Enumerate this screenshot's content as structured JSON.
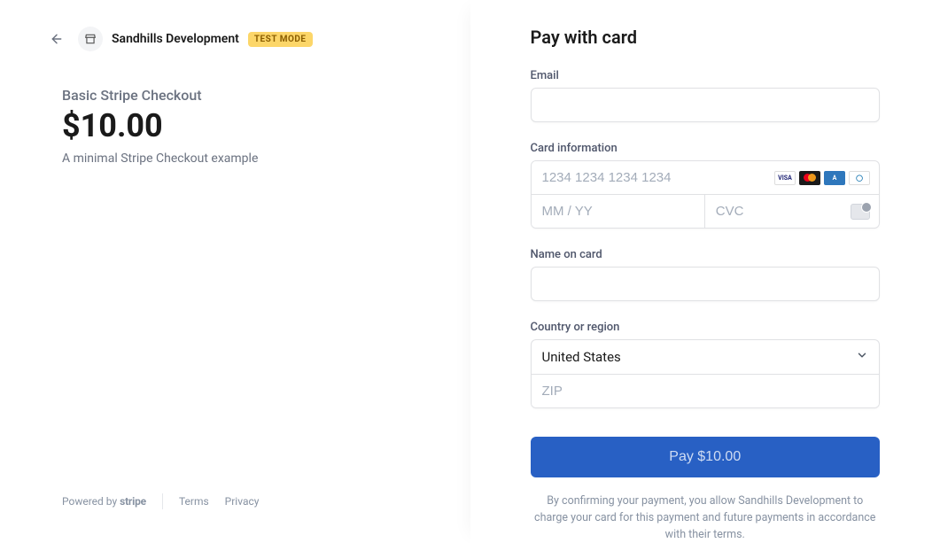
{
  "merchant": {
    "name": "Sandhills Development",
    "badge": "TEST MODE"
  },
  "product": {
    "name": "Basic Stripe Checkout",
    "price": "$10.00",
    "description": "A minimal Stripe Checkout example"
  },
  "footer": {
    "powered_prefix": "Powered by ",
    "stripe": "stripe",
    "terms": "Terms",
    "privacy": "Privacy"
  },
  "form": {
    "title": "Pay with card",
    "email_label": "Email",
    "card_label": "Card information",
    "card_number_placeholder": "1234 1234 1234 1234",
    "expiry_placeholder": "MM / YY",
    "cvc_placeholder": "CVC",
    "name_label": "Name on card",
    "country_label": "Country or region",
    "country_value": "United States",
    "zip_placeholder": "ZIP",
    "pay_button": "Pay $10.00",
    "disclaimer": "By confirming your payment, you allow Sandhills Development to charge your card for this payment and future payments in accordance with their terms."
  }
}
